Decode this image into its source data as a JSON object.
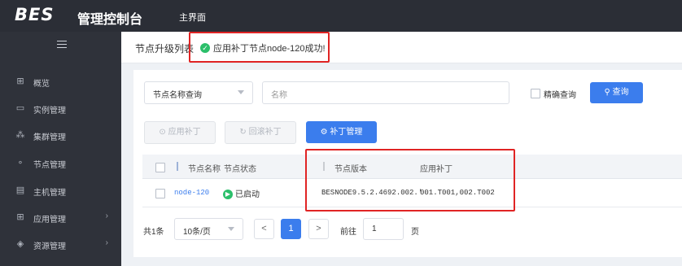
{
  "header": {
    "logo": "BES",
    "title": "管理控制台",
    "nav_home": "主界面"
  },
  "sidebar": {
    "items": [
      {
        "label": "概览",
        "icon": "grid-icon",
        "glyph": "⊞"
      },
      {
        "label": "实例管理",
        "icon": "instance-icon",
        "glyph": "▭"
      },
      {
        "label": "集群管理",
        "icon": "cluster-icon",
        "glyph": "⁂"
      },
      {
        "label": "节点管理",
        "icon": "node-icon",
        "glyph": "∘"
      },
      {
        "label": "主机管理",
        "icon": "host-icon",
        "glyph": "▤"
      },
      {
        "label": "应用管理",
        "icon": "app-icon",
        "glyph": "⊞",
        "chevron": "›"
      },
      {
        "label": "资源管理",
        "icon": "resource-icon",
        "glyph": "◈",
        "chevron": "›"
      }
    ]
  },
  "content": {
    "section_title": "节点升级列表",
    "success_message": "应用补丁节点node-120成功!"
  },
  "filter": {
    "select_value": "节点名称查询",
    "name_placeholder": "名称",
    "exact_label": "精确查询",
    "query_button": "查询",
    "query_icon": "🔍"
  },
  "actions": {
    "apply_patch": "应用补丁",
    "rollback_patch": "回滚补丁",
    "patch_manage": "补丁管理"
  },
  "table": {
    "columns": [
      "节点名称",
      "节点状态",
      "节点版本",
      "应用补丁"
    ],
    "rows": [
      {
        "name": "node-120",
        "status": "已启动",
        "version": "BESNODE9.5.2.4692.002.'",
        "patches": "001.T001,002.T002"
      }
    ]
  },
  "pagination": {
    "total": "共1条",
    "page_size": "10条/页",
    "prev": "<",
    "current": "1",
    "next": ">",
    "goto_label": "前往",
    "goto_value": "1",
    "page_unit": "页"
  },
  "colors": {
    "accent": "#3b7ded",
    "success": "#2bbf6a",
    "highlight": "#e02424",
    "sidebar": "#2f323a"
  }
}
